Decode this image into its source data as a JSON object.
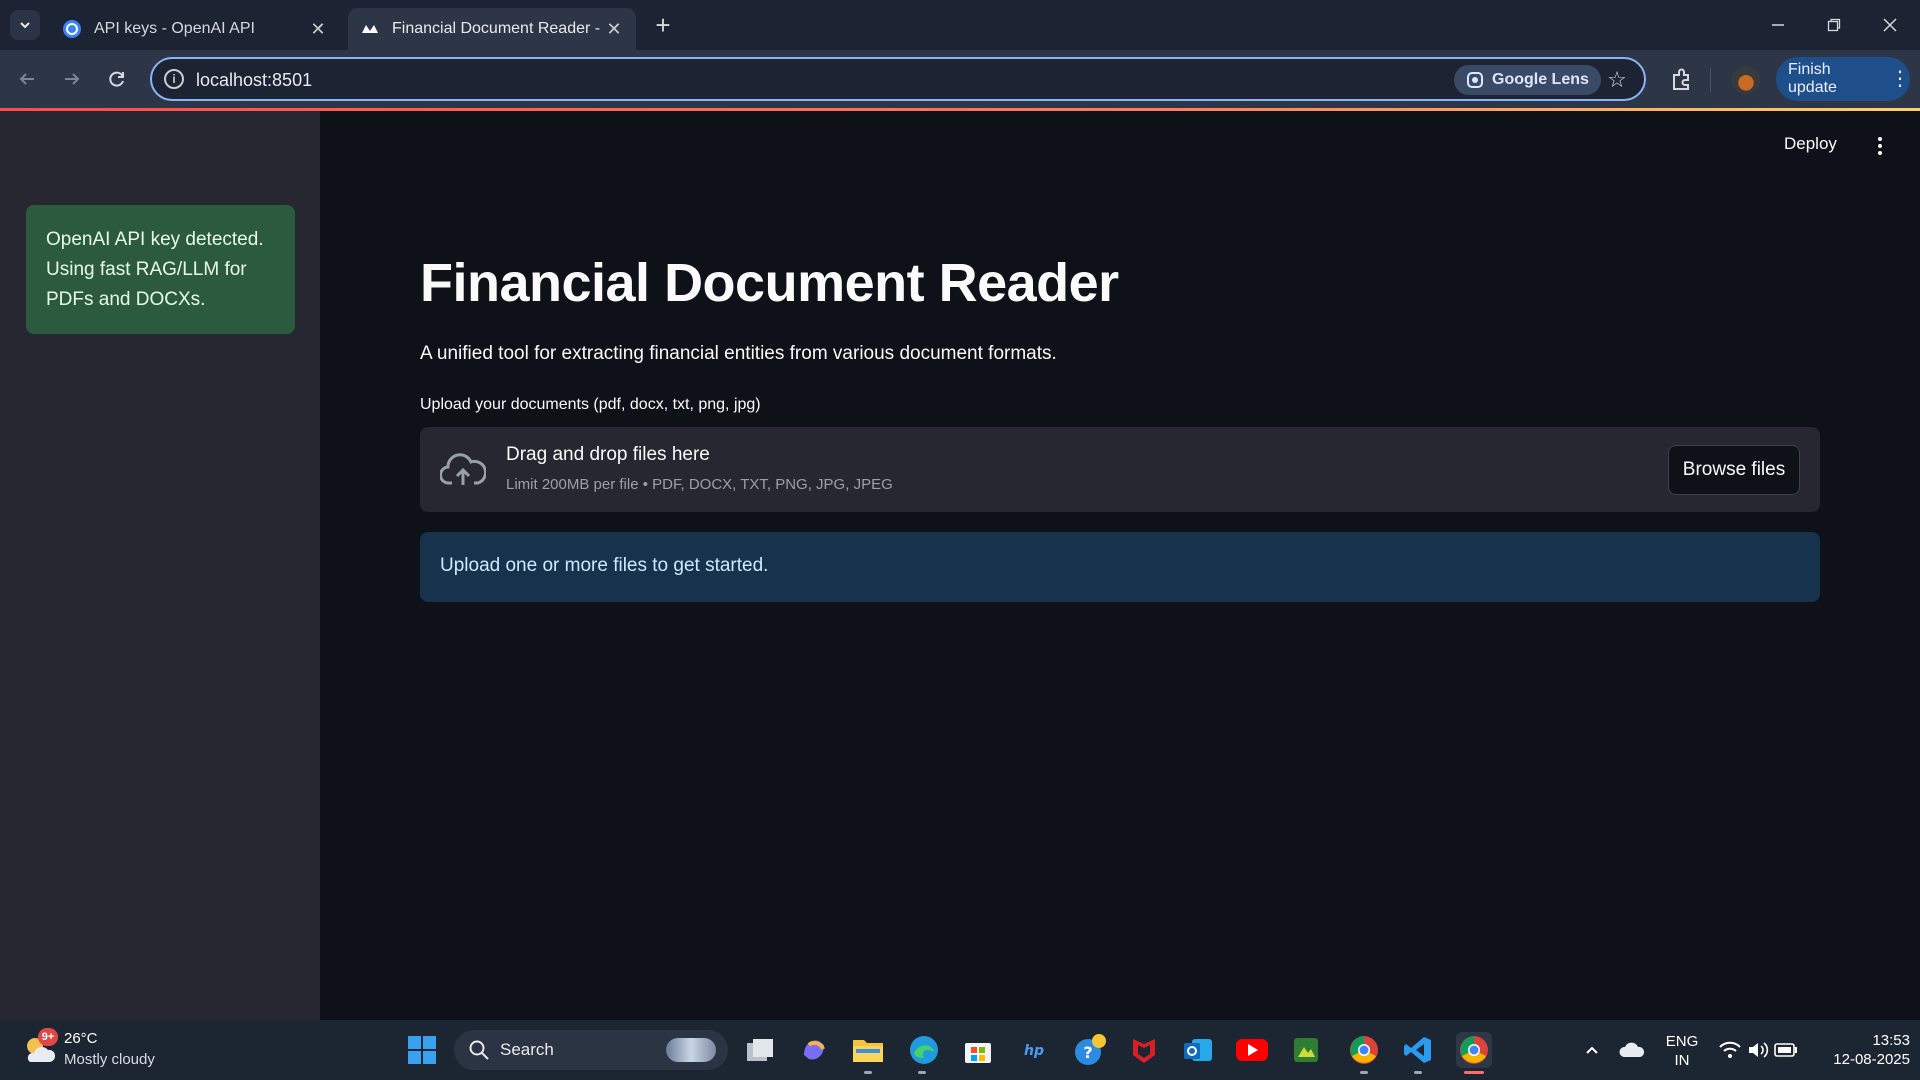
{
  "browser": {
    "tabs": [
      {
        "title": "API keys - OpenAI API",
        "favicon": "openai-icon",
        "active": false
      },
      {
        "title": "Financial Document Reader - Un",
        "favicon": "streamlit-icon",
        "active": true
      }
    ],
    "url": "localhost:8501",
    "google_lens_label": "Google Lens",
    "finish_update_label": "Finish update"
  },
  "app": {
    "deploy_label": "Deploy",
    "sidebar": {
      "success_message": "OpenAI API key detected. Using fast RAG/LLM for PDFs and DOCXs."
    },
    "title": "Financial Document Reader",
    "subtitle": "A unified tool for extracting financial entities from various document formats.",
    "uploader": {
      "label": "Upload your documents (pdf, docx, txt, png, jpg)",
      "drop_title": "Drag and drop files here",
      "limit_hint": "Limit 200MB per file • PDF, DOCX, TXT, PNG, JPG, JPEG",
      "browse_label": "Browse files"
    },
    "info_message": "Upload one or more files to get started.",
    "colors": {
      "background": "#0e1117",
      "sidebar": "#262730",
      "success": "#2b5a3f",
      "info": "#17324d"
    }
  },
  "taskbar": {
    "weather_badge": "9+",
    "temperature": "26°C",
    "weather_desc": "Mostly cloudy",
    "search_label": "Search",
    "language": "ENG",
    "region": "IN",
    "time": "13:53",
    "date": "12-08-2025"
  }
}
